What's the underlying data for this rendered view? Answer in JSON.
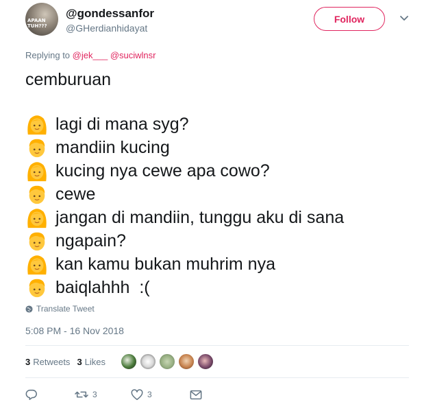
{
  "author": {
    "display_name": "@gondessanfor",
    "screen_name": "@GHerdianhidayat",
    "avatar_text": "APAAN TUH???"
  },
  "follow_button": {
    "label": "Follow"
  },
  "reply": {
    "prefix": "Replying to",
    "mentions": [
      "@jek___",
      "@suciwlnsr"
    ]
  },
  "tweet": {
    "first_line": "cemburuan",
    "dialogue": [
      {
        "speaker": "girl",
        "text": "lagi di mana syg?"
      },
      {
        "speaker": "boy",
        "text": "mandiin kucing"
      },
      {
        "speaker": "girl",
        "text": "kucing nya cewe apa cowo?"
      },
      {
        "speaker": "boy",
        "text": "cewe"
      },
      {
        "speaker": "girl",
        "text": "jangan di mandiin, tunggu aku di sana"
      },
      {
        "speaker": "boy",
        "text": "ngapain?"
      },
      {
        "speaker": "girl",
        "text": "kan kamu bukan muhrim nya"
      },
      {
        "speaker": "boy",
        "text": "baiqlahhh  :("
      }
    ]
  },
  "translate": {
    "label": "Translate Tweet",
    "icon": "globe-icon"
  },
  "timestamp": "5:08 PM - 16 Nov 2018",
  "stats": {
    "retweets_count": "3",
    "retweets_label": "Retweets",
    "likes_count": "3",
    "likes_label": "Likes"
  },
  "actions": {
    "reply_icon": "reply-icon",
    "retweet_count": "3",
    "like_count": "3",
    "dm_icon": "envelope-icon"
  },
  "colors": {
    "accent": "#e0245e",
    "muted_text": "#657786",
    "body_text": "#14171a",
    "divider": "#e6ecf0"
  }
}
